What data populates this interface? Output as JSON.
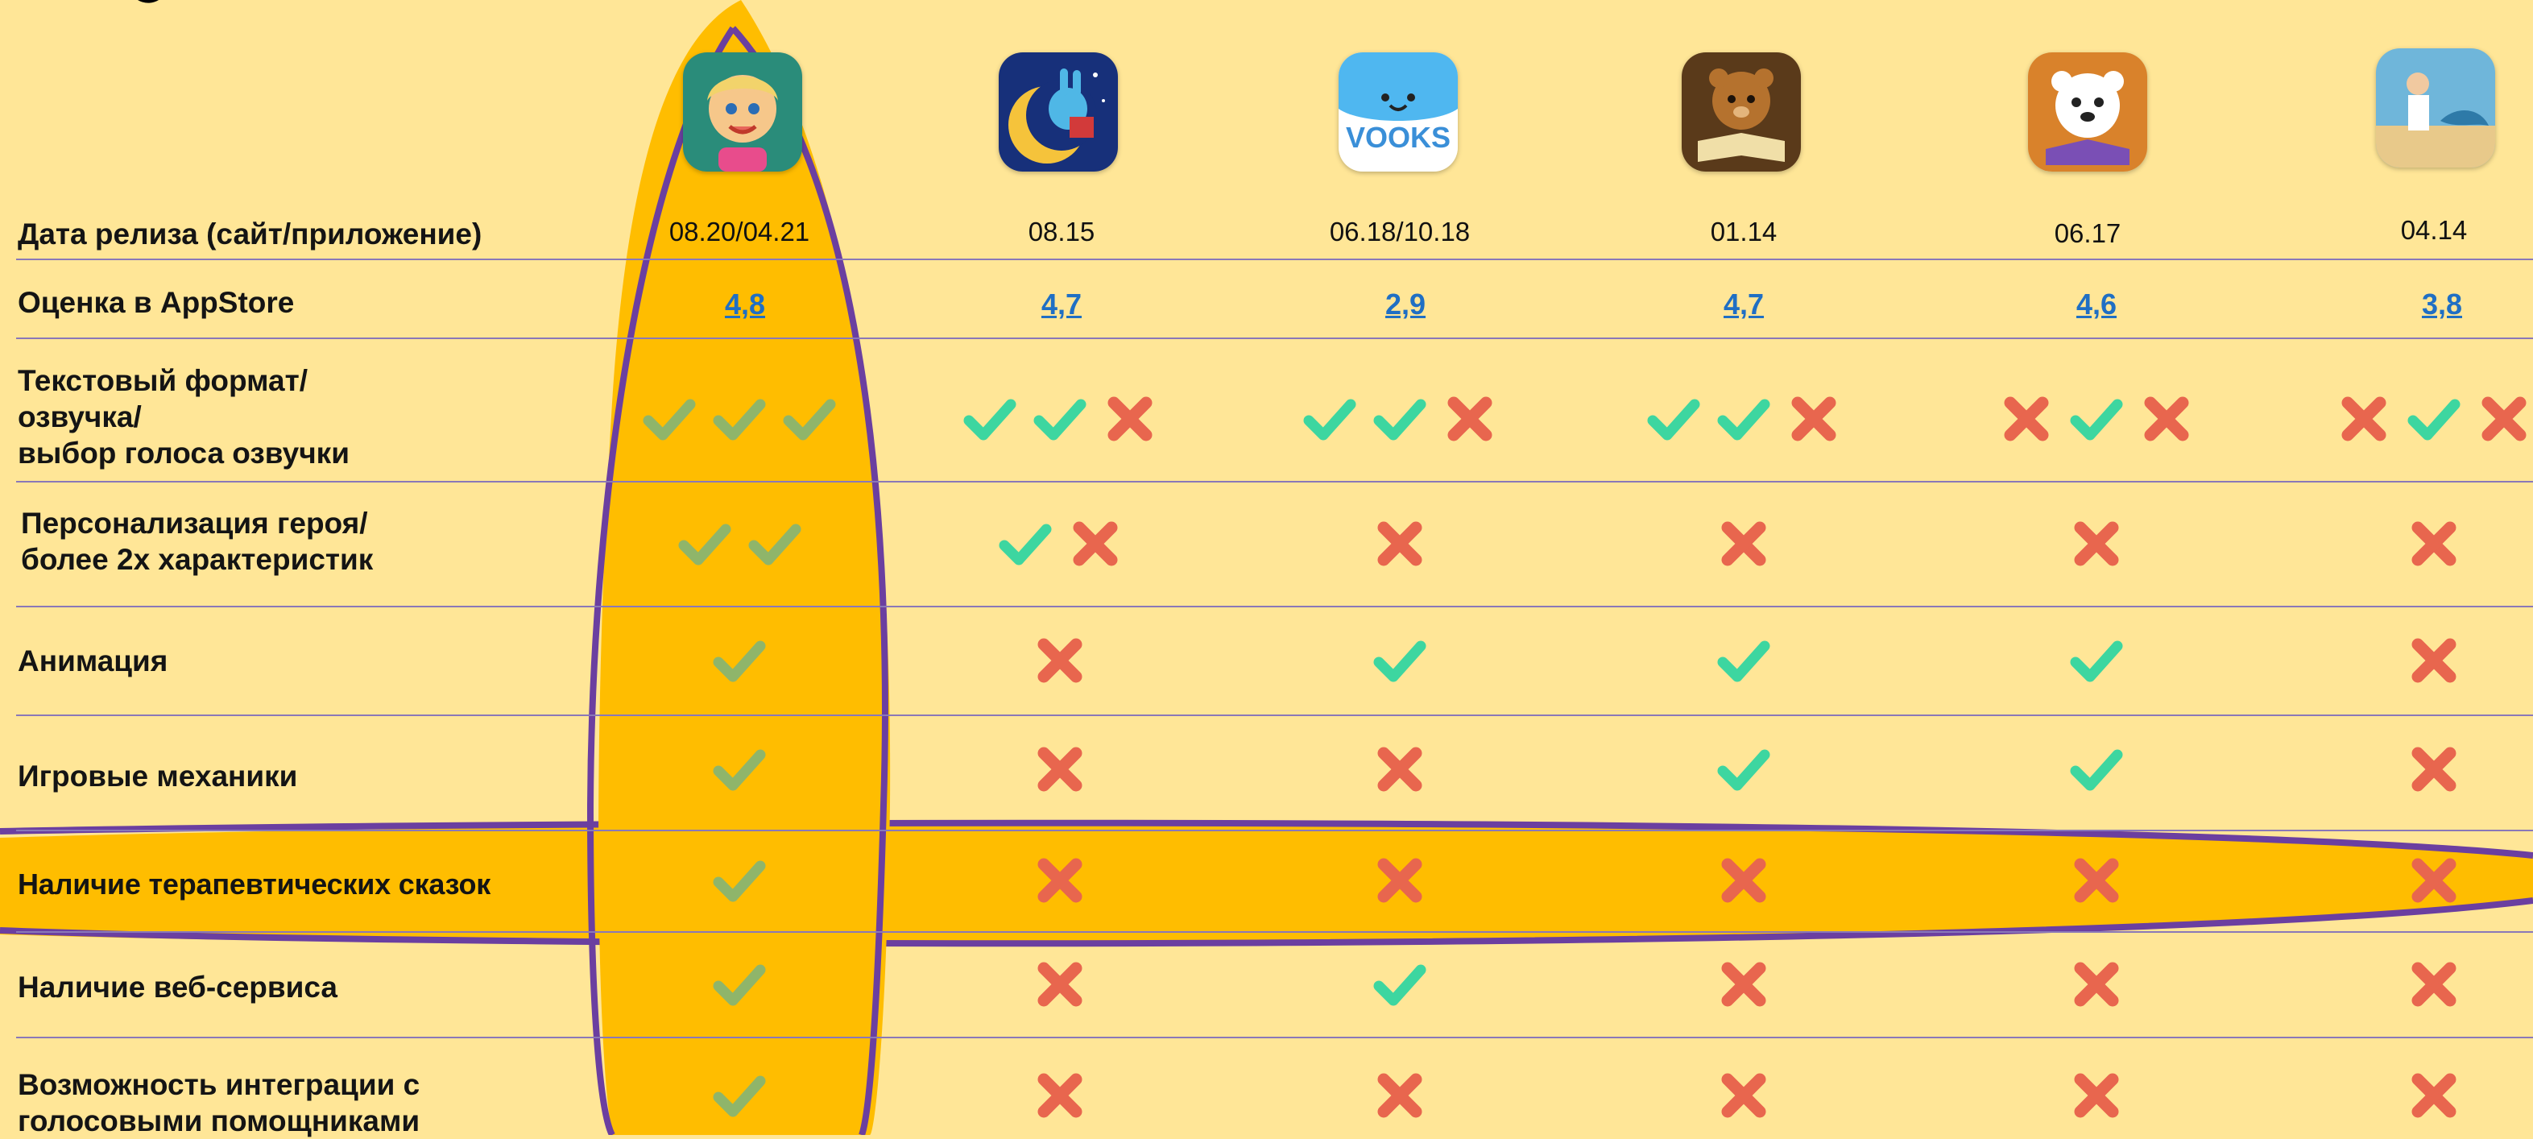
{
  "apps": [
    {
      "name": "app-1",
      "icon": "girl-face-icon"
    },
    {
      "name": "app-2",
      "icon": "bunny-moon-icon"
    },
    {
      "name": "app-3",
      "icon": "vooks-cloud-icon",
      "text": "VOOKS"
    },
    {
      "name": "app-4",
      "icon": "bear-book-icon"
    },
    {
      "name": "app-5",
      "icon": "white-bear-icon"
    },
    {
      "name": "app-6",
      "icon": "fisherman-icon"
    }
  ],
  "rows": [
    {
      "label": "Дата релиза (сайт/приложение)"
    },
    {
      "label": "Оценка в AppStore"
    },
    {
      "label_lines": [
        "Текстовый формат/",
        "озвучка/",
        "выбор голоса озвучки"
      ]
    },
    {
      "label_lines": [
        "Персонализация героя/",
        "более 2х характеристик"
      ]
    },
    {
      "label": "Анимация"
    },
    {
      "label": "Игровые механики"
    },
    {
      "label": "Наличие терапевтических сказок"
    },
    {
      "label": "Наличие веб-сервиса"
    },
    {
      "label_lines": [
        "Возможность интеграции с",
        "голосовыми помощниками"
      ]
    }
  ],
  "dates": [
    "08.20/04.21",
    "08.15",
    "06.18/10.18",
    "01.14",
    "06.17",
    "04.14"
  ],
  "ratings": [
    "4,8",
    "4,7",
    "2,9",
    "4,7",
    "4,6",
    "3,8"
  ],
  "features": [
    [
      [
        "yes",
        "yes",
        "yes"
      ],
      [
        "yes",
        "yes",
        "no"
      ],
      [
        "yes",
        "yes",
        "no"
      ],
      [
        "yes",
        "yes",
        "no"
      ],
      [
        "no",
        "yes",
        "no"
      ],
      [
        "no",
        "yes",
        "no"
      ]
    ],
    [
      [
        "yes",
        "yes"
      ],
      [
        "yes",
        "no"
      ],
      [
        "no"
      ],
      [
        "no"
      ],
      [
        "no"
      ],
      [
        "no"
      ]
    ],
    [
      [
        "yes"
      ],
      [
        "no"
      ],
      [
        "yes"
      ],
      [
        "yes"
      ],
      [
        "yes"
      ],
      [
        "no"
      ]
    ],
    [
      [
        "yes"
      ],
      [
        "no"
      ],
      [
        "no"
      ],
      [
        "yes"
      ],
      [
        "yes"
      ],
      [
        "no"
      ]
    ],
    [
      [
        "yes"
      ],
      [
        "no"
      ],
      [
        "no"
      ],
      [
        "no"
      ],
      [
        "no"
      ],
      [
        "no"
      ]
    ],
    [
      [
        "yes"
      ],
      [
        "no"
      ],
      [
        "yes"
      ],
      [
        "no"
      ],
      [
        "no"
      ],
      [
        "no"
      ]
    ],
    [
      [
        "yes"
      ],
      [
        "no"
      ],
      [
        "no"
      ],
      [
        "no"
      ],
      [
        "no"
      ],
      [
        "no"
      ]
    ]
  ],
  "colors": {
    "background": "#FFE697",
    "highlight_fill": "#FFBD00",
    "highlight_stroke": "#6B3FA0",
    "check": "#3DD6A0",
    "check_muted": "#8FB56A",
    "cross": "#E8664E",
    "rating_link": "#1F6FC4",
    "divider": "#8A78B8"
  }
}
